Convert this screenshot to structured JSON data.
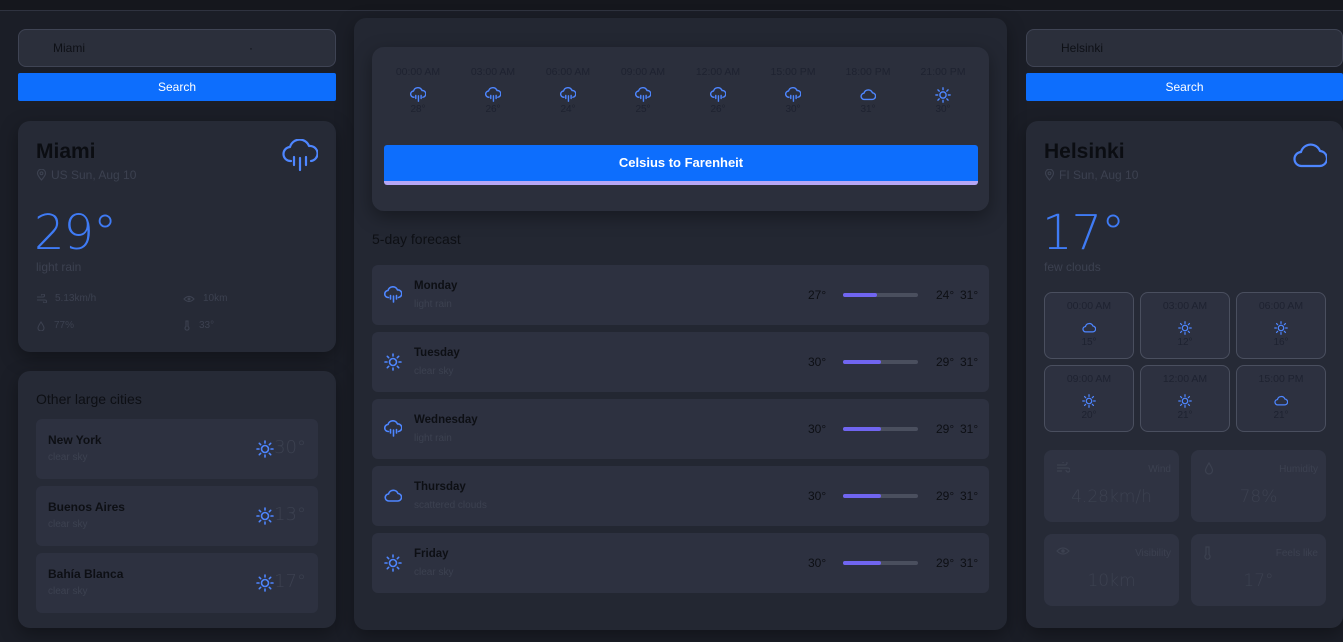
{
  "left": {
    "search": {
      "value": "Miami",
      "button_label": "Search"
    },
    "current": {
      "city": "Miami",
      "location": "US Sun, Aug 10",
      "icon": "rain-cloud-icon",
      "temp": "29°",
      "description": "light rain",
      "wind": "5.13km/h",
      "visibility": "10km",
      "humidity": "77%",
      "feels_like": "33°"
    },
    "other_cities": {
      "title": "Other large cities",
      "items": [
        {
          "name": "New York",
          "desc": "clear sky",
          "temp": "30°",
          "icon": "sun-icon"
        },
        {
          "name": "Buenos Aires",
          "desc": "clear sky",
          "temp": "13°",
          "icon": "sun-icon"
        },
        {
          "name": "Bahía Blanca",
          "desc": "clear sky",
          "temp": "17°",
          "icon": "sun-icon"
        }
      ]
    }
  },
  "center": {
    "hourly": [
      {
        "time": "00:00 AM",
        "temp": "28°",
        "icon": "rain-icon"
      },
      {
        "time": "03:00 AM",
        "temp": "26°",
        "icon": "rain-icon"
      },
      {
        "time": "06:00 AM",
        "temp": "24°",
        "icon": "rain-icon"
      },
      {
        "time": "09:00 AM",
        "temp": "25°",
        "icon": "rain-icon"
      },
      {
        "time": "12:00 AM",
        "temp": "26°",
        "icon": "rain-icon"
      },
      {
        "time": "15:00 PM",
        "temp": "30°",
        "icon": "rain-icon"
      },
      {
        "time": "18:00 PM",
        "temp": "31°",
        "icon": "cloud-icon"
      },
      {
        "time": "21:00 PM",
        "temp": "30°",
        "icon": "sun-icon"
      }
    ],
    "convert_button": "Celsius to Farenheit",
    "forecast_title": "5-day forecast",
    "days": [
      {
        "day": "Monday",
        "desc": "light rain",
        "current": "27°",
        "min": "24°",
        "max": "31°",
        "fill": 0.45,
        "icon": "rain-icon"
      },
      {
        "day": "Tuesday",
        "desc": "clear sky",
        "current": "30°",
        "min": "29°",
        "max": "31°",
        "fill": 0.5,
        "icon": "sun-icon"
      },
      {
        "day": "Wednesday",
        "desc": "light rain",
        "current": "30°",
        "min": "29°",
        "max": "31°",
        "fill": 0.5,
        "icon": "rain-icon"
      },
      {
        "day": "Thursday",
        "desc": "scattered clouds",
        "current": "30°",
        "min": "29°",
        "max": "31°",
        "fill": 0.5,
        "icon": "cloud-icon"
      },
      {
        "day": "Friday",
        "desc": "clear sky",
        "current": "30°",
        "min": "29°",
        "max": "31°",
        "fill": 0.5,
        "icon": "sun-icon"
      }
    ]
  },
  "right": {
    "search": {
      "value": "Helsinki",
      "button_label": "Search"
    },
    "current": {
      "city": "Helsinki",
      "location": "FI Sun, Aug 10",
      "icon": "cloud-icon",
      "temp": "17°",
      "description": "few clouds"
    },
    "hourly": [
      {
        "time": "00:00 AM",
        "temp": "15°",
        "icon": "cloud-icon"
      },
      {
        "time": "03:00 AM",
        "temp": "12°",
        "icon": "sun-icon"
      },
      {
        "time": "06:00 AM",
        "temp": "16°",
        "icon": "sun-icon"
      },
      {
        "time": "09:00 AM",
        "temp": "20°",
        "icon": "sun-icon"
      },
      {
        "time": "12:00 AM",
        "temp": "21°",
        "icon": "sun-icon"
      },
      {
        "time": "15:00 PM",
        "temp": "21°",
        "icon": "cloud-icon"
      }
    ],
    "stats": {
      "wind": {
        "label": "Wind",
        "value": "4.28km/h"
      },
      "humidity": {
        "label": "Humidity",
        "value": "78%"
      },
      "visibility": {
        "label": "Visibility",
        "value": "10km"
      },
      "feels_like": {
        "label": "Feels like",
        "value": "17°"
      }
    }
  },
  "colors": {
    "accent": "#0d6efd",
    "icon_blue": "#4e86ff",
    "bar_fill": "#7065f0"
  }
}
